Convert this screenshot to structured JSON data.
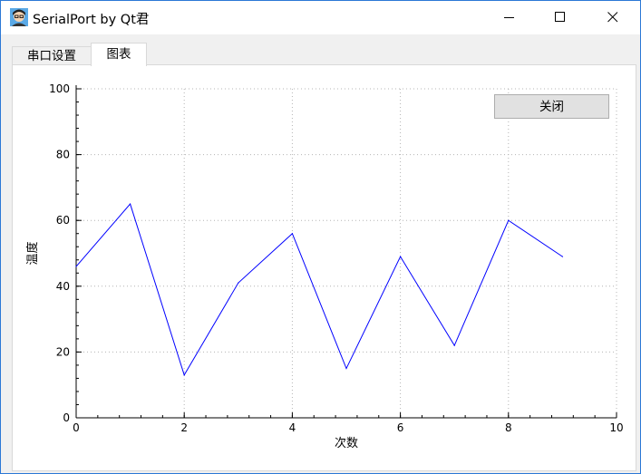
{
  "window": {
    "title": "SerialPort by Qt君",
    "controls": [
      "minimize",
      "maximize",
      "close"
    ]
  },
  "tabs": [
    {
      "label": "串口设置",
      "active": false
    },
    {
      "label": "图表",
      "active": true
    }
  ],
  "panel": {
    "close_button_label": "关闭"
  },
  "chart_data": {
    "type": "line",
    "title": "",
    "xlabel": "次数",
    "ylabel": "温度",
    "xlim": [
      0,
      10
    ],
    "ylim": [
      0,
      100
    ],
    "xticks": [
      0,
      2,
      4,
      6,
      8,
      10
    ],
    "yticks": [
      0,
      20,
      40,
      60,
      80,
      100
    ],
    "grid": true,
    "series": [
      {
        "color": "#0000ff",
        "x": [
          0,
          1,
          2,
          3,
          4,
          5,
          6,
          7,
          8,
          9
        ],
        "y": [
          46,
          65,
          13,
          41,
          56,
          15,
          49,
          22,
          60,
          49
        ]
      }
    ]
  }
}
